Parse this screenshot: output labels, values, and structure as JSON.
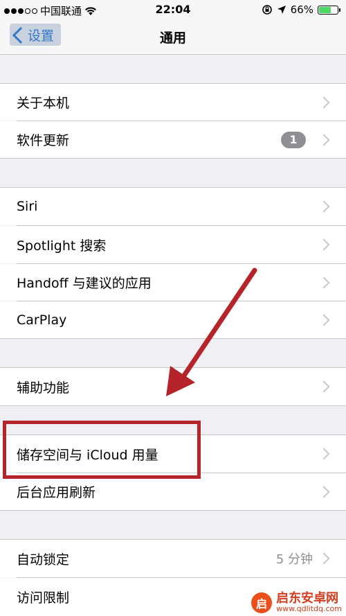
{
  "status_bar": {
    "carrier": "中国联通",
    "time": "22:04",
    "battery_percent": "66%",
    "battery_level": 0.66,
    "battery_color": "#4cd964"
  },
  "nav": {
    "back_label": "设置",
    "title": "通用"
  },
  "groups": {
    "g1": {
      "about": "关于本机",
      "software_update": "软件更新",
      "update_badge": "1"
    },
    "g2": {
      "siri": "Siri",
      "spotlight": "Spotlight 搜索",
      "handoff": "Handoff 与建议的应用",
      "carplay": "CarPlay"
    },
    "g3": {
      "accessibility": "辅助功能"
    },
    "g4": {
      "storage": "储存空间与 iCloud 用量",
      "background_refresh": "后台应用刷新"
    },
    "g5": {
      "auto_lock": "自动锁定",
      "auto_lock_value": "5 分钟",
      "restrictions": "访问限制"
    }
  },
  "annotation": {
    "color": "#b5242b"
  },
  "watermark": {
    "brand": "启东安卓网",
    "url": "www.qdlitdq.com"
  }
}
